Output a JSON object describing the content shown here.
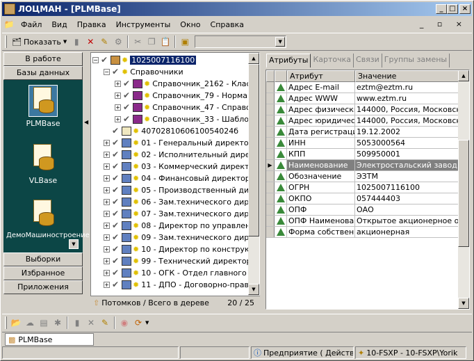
{
  "window": {
    "title": "ЛОЦМАН - [PLMBase]",
    "min": "_",
    "max": "□",
    "close": "×"
  },
  "menu": [
    "Файл",
    "Вид",
    "Правка",
    "Инструменты",
    "Окно",
    "Справка"
  ],
  "mdi_controls": "_ ▫ ×",
  "toolbar": {
    "show_label": "Показать"
  },
  "nav": {
    "top": [
      "В работе",
      "Базы данных"
    ],
    "bottom": [
      "Выборки",
      "Избранное",
      "Приложения"
    ],
    "databases": [
      "PLMBase",
      "VLBase",
      "ДемоМашиностроение"
    ]
  },
  "tree": {
    "root": "1025007116100",
    "folder": "Справочники",
    "refs": [
      "Справочник_2162 - Клас",
      "Справочник_79 - Норма",
      "Справочник_47 - Справо",
      "Справочник_33 - Шабло"
    ],
    "item": "4070281060610054024б",
    "items": [
      "01 - Генеральный директор",
      "02 - Исполнительный дирек",
      "03 - Коммерческий директо",
      "04 - Финансовый директор",
      "05 - Производственный дир",
      "06 - Зам.технического дире",
      "07 - Зам.технического дире",
      "08 - Директор по управлен",
      "09 - Зам.технического дире",
      "10 - Директор по конструкт",
      "99 - Технический директор",
      "10 - ОГК - Отдел главного к",
      "11 - ДПО - Договорно-прав"
    ],
    "footer_label": "Потомков / Всего в дереве",
    "footer_count": "20 / 25"
  },
  "tabs": [
    "Атрибуты",
    "Карточка",
    "Связи",
    "Группы замены"
  ],
  "grid": {
    "headers": [
      "Атрибут",
      "Значение"
    ],
    "rows": [
      [
        "Адрес E-mail",
        "eztm@eztm.ru"
      ],
      [
        "Адрес WWW",
        "www.eztm.ru"
      ],
      [
        "Адрес физический",
        "144000, Россия, Московска"
      ],
      [
        "Адрес юридически",
        "144000, Россия, Московска"
      ],
      [
        "Дата регистрации",
        "19.12.2002"
      ],
      [
        "ИНН",
        "5053000564"
      ],
      [
        "КПП",
        "509950001"
      ],
      [
        "Наименование",
        "Электростальский завод тя"
      ],
      [
        "Обозначение",
        "ЭЗТМ"
      ],
      [
        "ОГРН",
        "1025007116100"
      ],
      [
        "ОКПО",
        "057444403"
      ],
      [
        "ОПФ",
        "ОАО"
      ],
      [
        "ОПФ Наименован",
        "Открытое акционерное общ"
      ],
      [
        "Форма собственно",
        "акционерная"
      ]
    ]
  },
  "taskbar": {
    "item": "PLMBase"
  },
  "status": {
    "enterprise": "Предприятие ( Действит",
    "user": "10-FSXP - 10-FSXP\\Yorik"
  }
}
